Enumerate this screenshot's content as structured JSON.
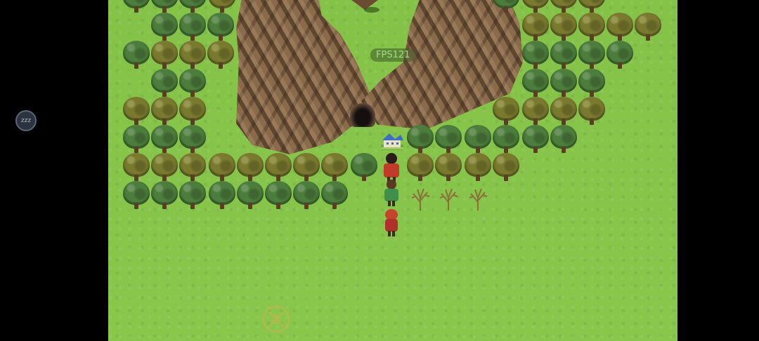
{
  "hud": {
    "fps_text": "FPS121"
  },
  "overlay": {
    "sleep_button_label": "zzz"
  },
  "icons": {
    "sleep": "sleep-icon",
    "destination": "destination-marker-icon",
    "house": "house-icon"
  },
  "colors": {
    "grass": "#86c54a",
    "tree_green": "#4d7d3c",
    "tree_olive": "#7a7a2f",
    "mountain": "#8a6a48"
  }
}
